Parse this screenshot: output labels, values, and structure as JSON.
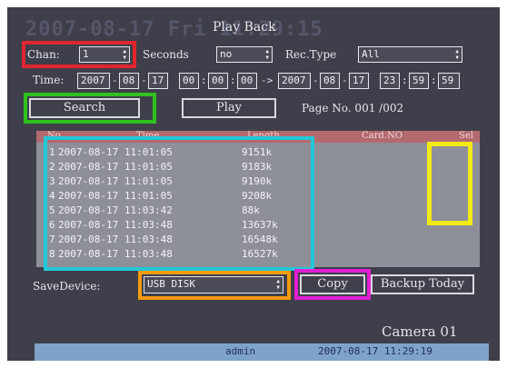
{
  "overlay": {
    "background_date": "2007-08-17 Fri 11:29:15",
    "title": "Play Back"
  },
  "controls": {
    "chan_label": "Chan:",
    "chan_value": "1",
    "seconds_label": "Seconds",
    "seconds_value": "no",
    "rec_type_label": "Rec.Type",
    "rec_type_value": "All"
  },
  "time_range": {
    "label": "Time:",
    "start": {
      "year": "2007",
      "month": "08",
      "day": "17",
      "hour": "00",
      "minute": "00",
      "second": "00"
    },
    "separator": "->",
    "end": {
      "year": "2007",
      "month": "08",
      "day": "17",
      "hour": "23",
      "minute": "59",
      "second": "59"
    }
  },
  "actions": {
    "search_label": "Search",
    "play_label": "Play",
    "page_label": "Page No. 001 /002"
  },
  "table": {
    "headers": {
      "no": "No.",
      "time": "Time",
      "length": "Length",
      "card": "Card.NO",
      "sel": "Sel"
    },
    "rows": [
      {
        "no": "1",
        "time": "2007-08-17 11:01:05",
        "length": "9151k"
      },
      {
        "no": "2",
        "time": "2007-08-17 11:01:05",
        "length": "9183k"
      },
      {
        "no": "3",
        "time": "2007-08-17 11:01:05",
        "length": "9190k"
      },
      {
        "no": "4",
        "time": "2007-08-17 11:01:05",
        "length": "9208k"
      },
      {
        "no": "5",
        "time": "2007-08-17 11:03:42",
        "length": "88k"
      },
      {
        "no": "6",
        "time": "2007-08-17 11:03:48",
        "length": "13637k"
      },
      {
        "no": "7",
        "time": "2007-08-17 11:03:48",
        "length": "16548k"
      },
      {
        "no": "8",
        "time": "2007-08-17 11:03:48",
        "length": "16527k"
      }
    ]
  },
  "save": {
    "label": "SaveDevice:",
    "device": "USB DISK",
    "copy_label": "Copy",
    "backup_label": "Backup Today"
  },
  "camera_label": "Camera 01",
  "status_bar": {
    "user": "admin",
    "datetime": "2007-08-17 11:29:19"
  },
  "colors": {
    "highlight_red": "#e0262f",
    "highlight_green": "#2fc11e",
    "highlight_cyan": "#22c8d6",
    "highlight_yellow": "#f2ea14",
    "highlight_orange": "#f59a12",
    "highlight_magenta": "#e21fd4"
  }
}
